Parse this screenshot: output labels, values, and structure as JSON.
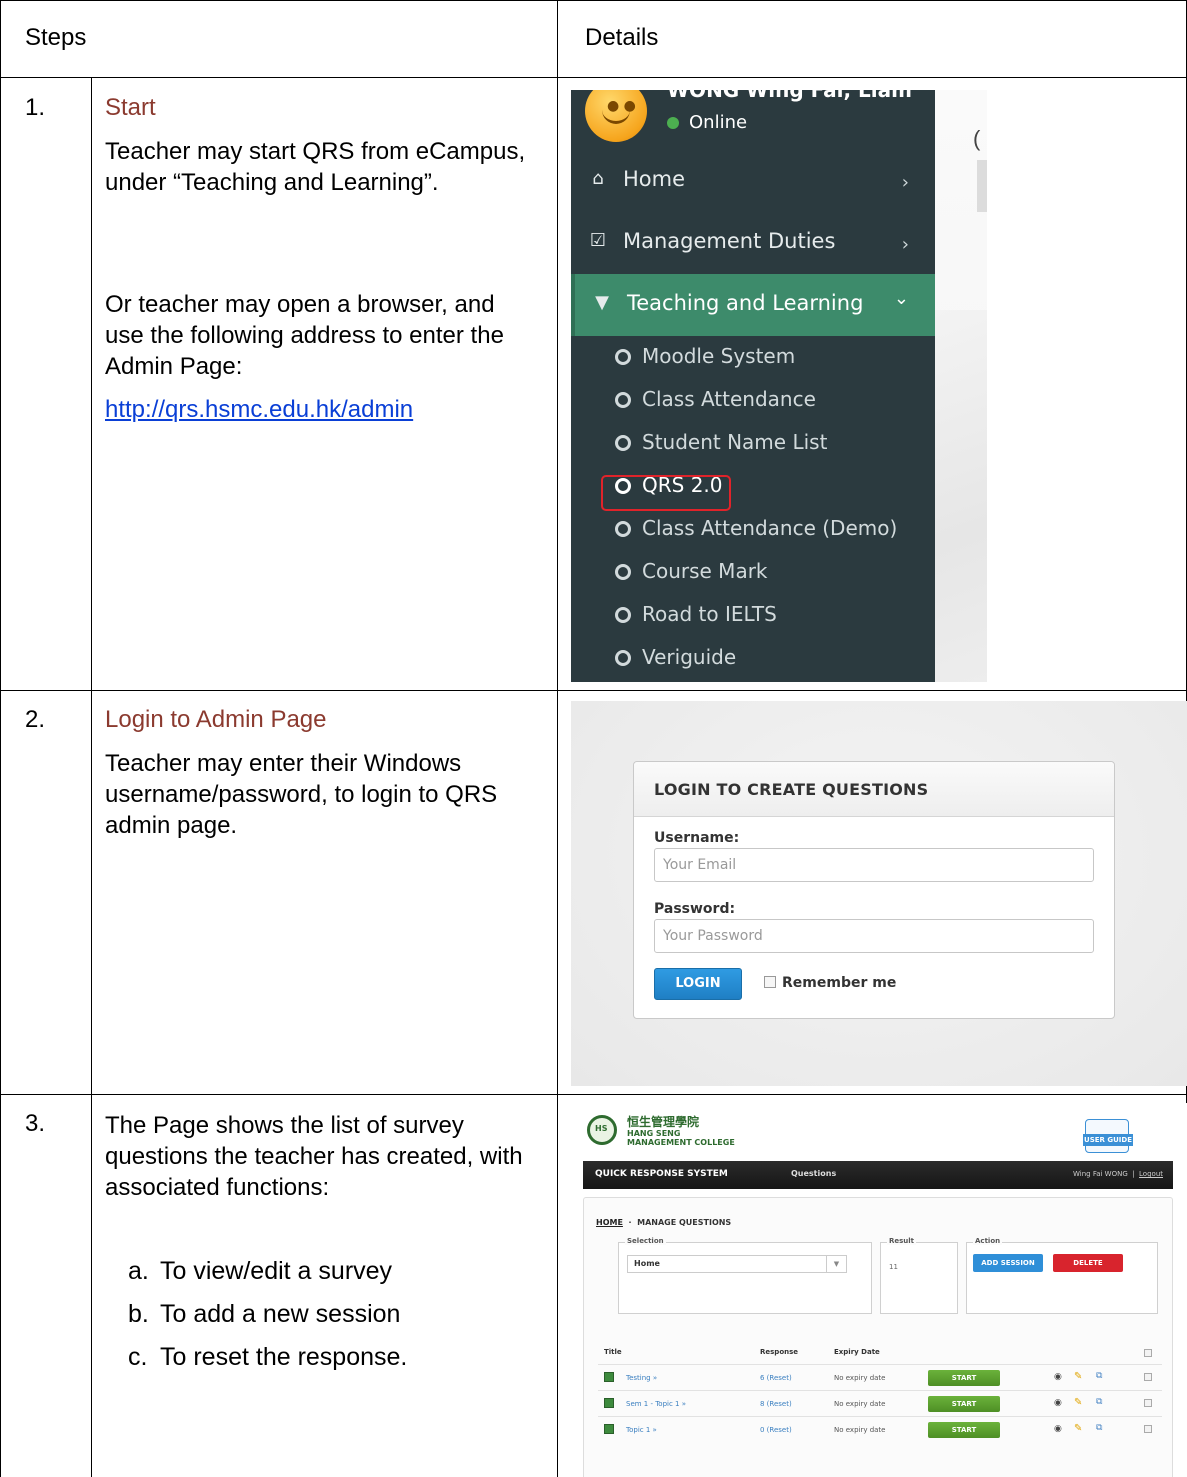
{
  "table": {
    "header_steps": "Steps",
    "header_details": "Details"
  },
  "steps": [
    {
      "number": "1.",
      "title": "Start",
      "para1": "Teacher may start QRS from eCampus, under “Teaching and Learning”.",
      "para2": "Or teacher may open a browser, and use the following address to enter the Admin Page:",
      "link": "http://qrs.hsmc.edu.hk/admin"
    },
    {
      "number": "2.",
      "title": "Login to Admin Page",
      "para1": "Teacher may enter their Windows username/password, to login to QRS admin page."
    },
    {
      "number": "3.",
      "para1": "The Page shows the list of survey questions the teacher has created, with associated functions:",
      "items": [
        {
          "letter": "a.",
          "text": "To view/edit a survey"
        },
        {
          "letter": "b.",
          "text": "To add a new session"
        },
        {
          "letter": "c.",
          "text": "To reset the response."
        }
      ]
    }
  ],
  "ecampus": {
    "user_name": "WONG Wing Fai, Liam",
    "status": "Online",
    "right_partial": "(",
    "nav": [
      {
        "icon": "home-icon",
        "label": "Home",
        "chevron": "›"
      },
      {
        "icon": "checkbox-icon",
        "label": "Management Duties",
        "chevron": "›"
      },
      {
        "icon": "graduation-cap-icon",
        "label": "Teaching and Learning",
        "chevron": "⌄"
      }
    ],
    "submenu": [
      "Moodle System",
      "Class Attendance",
      "Student Name List",
      "QRS 2.0",
      "Class Attendance (Demo)",
      "Course Mark",
      "Road to IELTS",
      "Veriguide"
    ],
    "highlighted": "QRS 2.0",
    "highlight_color": "#e0232a",
    "active_color": "#3d8b6b"
  },
  "login": {
    "title": "LOGIN TO CREATE QUESTIONS",
    "username_label": "Username:",
    "username_placeholder": "Your Email",
    "password_label": "Password:",
    "password_placeholder": "Your Password",
    "button": "LOGIN",
    "remember": "Remember me",
    "button_color": "#1f7fc4"
  },
  "qrs": {
    "logo_cn": "恒生管理學院",
    "logo_en1": "HANG SENG",
    "logo_en2": "MANAGEMENT COLLEGE",
    "user_guide": "USER GUIDE",
    "app_name": "QUICK RESPONSE SYSTEM",
    "nav_questions": "Questions",
    "user": "Wing Fai WONG",
    "separator": "|",
    "logout": "Logout",
    "crumb_home": "HOME",
    "crumb_sep": "·",
    "crumb_page": "MANAGE QUESTIONS",
    "selection_label": "Selection",
    "selection_value": "Home",
    "result_label": "Result",
    "result_value": "11",
    "action_label": "Action",
    "add_session": "ADD SESSION",
    "delete": "DELETE",
    "col_title": "Title",
    "col_response": "Response",
    "col_expiry": "Expiry Date",
    "rows": [
      {
        "title": "Testing »",
        "response": "6 (Reset)",
        "expiry": "No expiry date",
        "start": "START"
      },
      {
        "title": "Sem 1 - Topic 1 »",
        "response": "8 (Reset)",
        "expiry": "No expiry date",
        "start": "START"
      },
      {
        "title": "Topic 1 »",
        "response": "0 (Reset)",
        "expiry": "No expiry date",
        "start": "START"
      }
    ]
  }
}
